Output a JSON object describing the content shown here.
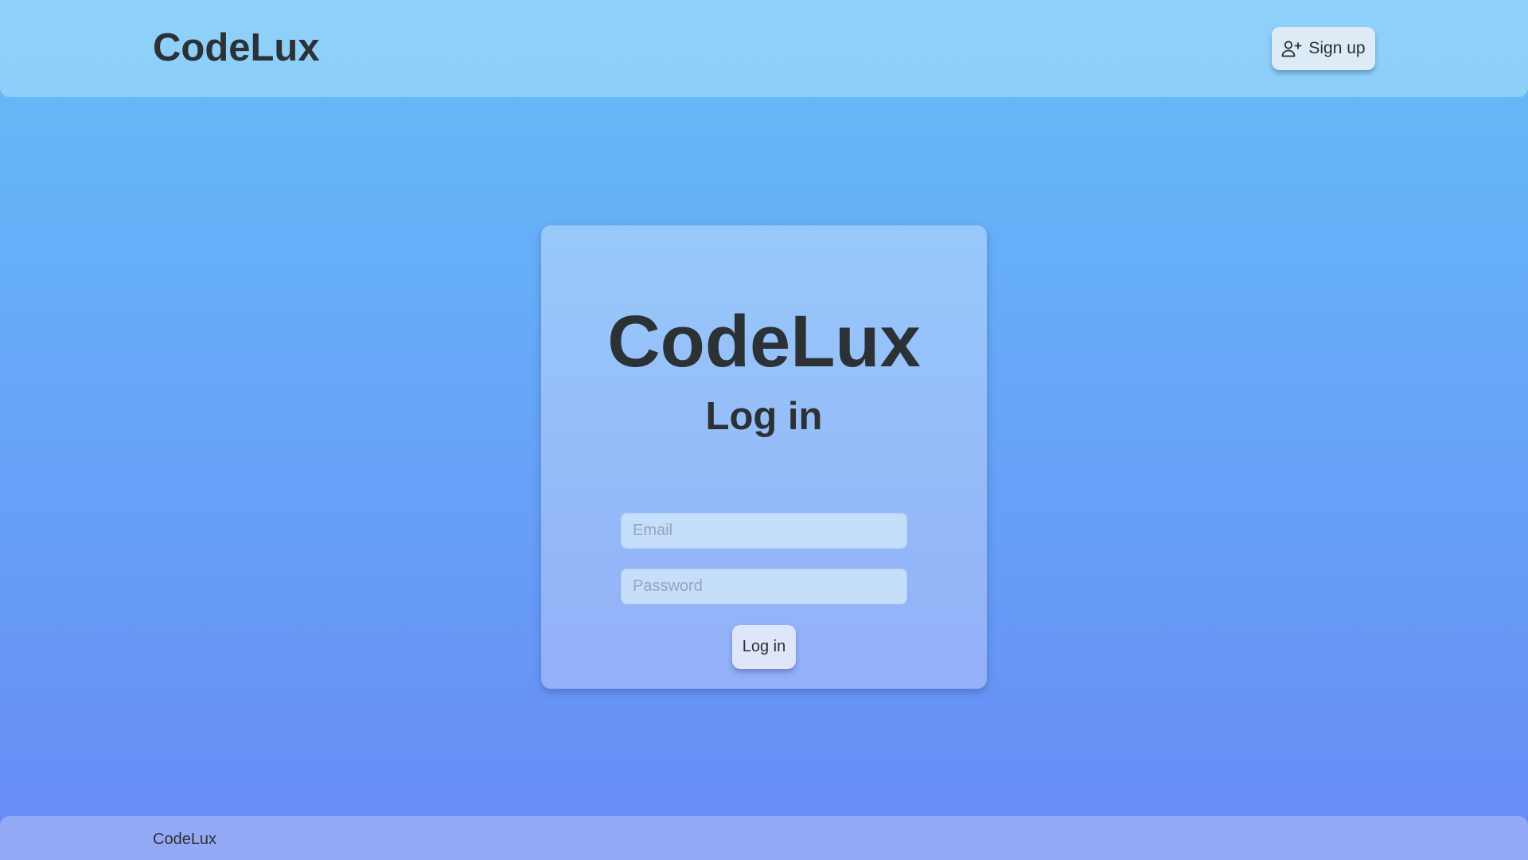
{
  "header": {
    "brand": "CodeLux",
    "signup_label": "Sign up",
    "signup_icon": "user-plus-icon"
  },
  "login_card": {
    "brand": "CodeLux",
    "title": "Log in",
    "email_placeholder": "Email",
    "email_value": "",
    "password_placeholder": "Password",
    "password_value": "",
    "submit_label": "Log in"
  },
  "footer": {
    "brand": "CodeLux"
  },
  "colors": {
    "background_top": "#66bdf8",
    "background_bottom": "#678bf6",
    "text": "#2b3134"
  }
}
